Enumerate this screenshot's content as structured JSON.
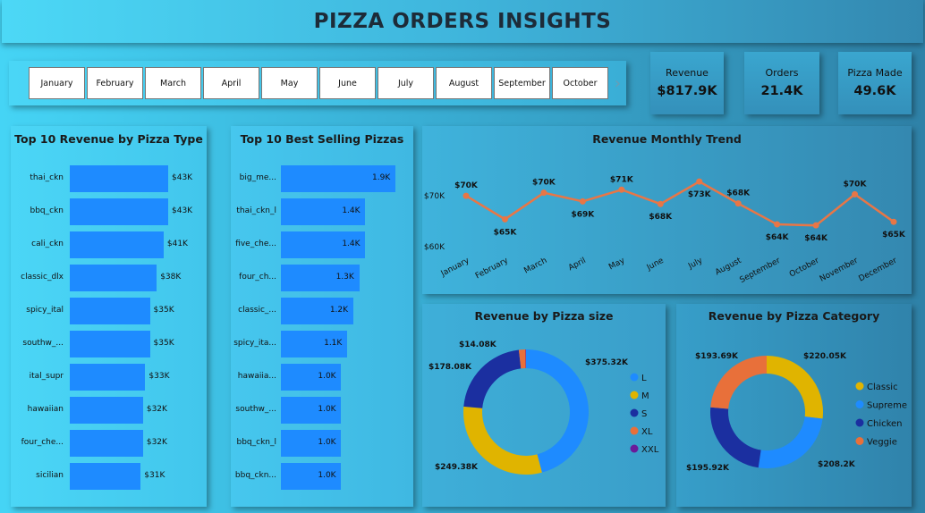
{
  "title": "PIZZA ORDERS INSIGHTS",
  "months": [
    "January",
    "February",
    "March",
    "April",
    "May",
    "June",
    "July",
    "August",
    "September",
    "October"
  ],
  "kpis": [
    {
      "label": "Revenue",
      "value": "$817.9K"
    },
    {
      "label": "Orders",
      "value": "21.4K"
    },
    {
      "label": "Pizza Made",
      "value": "49.6K"
    }
  ],
  "colors": {
    "bar": "#1e8bff",
    "line": "#e87646",
    "L": "#1e8bff",
    "M": "#e0b400",
    "S": "#1b2fa0",
    "XL": "#e8703a",
    "XXL": "#6a1b9a"
  },
  "chart_data": [
    {
      "type": "bar",
      "title": "Top 10 Revenue by Pizza Type",
      "categories": [
        "thai_ckn",
        "bbq_ckn",
        "cali_ckn",
        "classic_dlx",
        "spicy_ital",
        "southw_...",
        "ital_supr",
        "hawaiian",
        "four_che...",
        "sicilian"
      ],
      "values": [
        43,
        43,
        41,
        38,
        35,
        35,
        33,
        32,
        32,
        31
      ],
      "labels": [
        "$43K",
        "$43K",
        "$41K",
        "$38K",
        "$35K",
        "$35K",
        "$33K",
        "$32K",
        "$32K",
        "$31K"
      ]
    },
    {
      "type": "bar",
      "title": "Top 10 Best Selling Pizzas",
      "categories": [
        "big_me...",
        "thai_ckn_l",
        "five_che...",
        "four_ch...",
        "classic_...",
        "spicy_ita...",
        "hawaiia...",
        "southw_...",
        "bbq_ckn_l",
        "bbq_ckn..."
      ],
      "values": [
        1.9,
        1.4,
        1.4,
        1.3,
        1.2,
        1.1,
        1.0,
        1.0,
        1.0,
        1.0
      ],
      "labels": [
        "1.9K",
        "1.4K",
        "1.4K",
        "1.3K",
        "1.2K",
        "1.1K",
        "1.0K",
        "1.0K",
        "1.0K",
        "1.0K"
      ]
    },
    {
      "type": "line",
      "title": "Revenue Monthly Trend",
      "x": [
        "January",
        "February",
        "March",
        "April",
        "May",
        "June",
        "July",
        "August",
        "September",
        "October",
        "November",
        "December"
      ],
      "values": [
        69.8,
        65.2,
        70.4,
        68.7,
        71.0,
        68.2,
        72.6,
        68.3,
        64.2,
        64.0,
        70.1,
        64.7
      ],
      "labels": [
        "$70K",
        "$65K",
        "$70K",
        "$69K",
        "$71K",
        "$68K",
        "$73K",
        "$68K",
        "$64K",
        "$64K",
        "$70K",
        "$65K"
      ],
      "yticks": [
        "$70K",
        "$60K"
      ],
      "ylim": [
        60,
        75
      ]
    },
    {
      "type": "pie",
      "title": "Revenue by Pizza size",
      "categories": [
        "L",
        "M",
        "S",
        "XL",
        "XXL"
      ],
      "values": [
        375.32,
        249.38,
        178.08,
        14.08,
        1.0
      ],
      "labels": [
        "$375.32K",
        "$249.38K",
        "$178.08K",
        "$14.08K",
        ""
      ]
    },
    {
      "type": "pie",
      "title": "Revenue by Pizza Category",
      "categories": [
        "Classic",
        "Supreme",
        "Chicken",
        "Veggie"
      ],
      "values": [
        220.05,
        208.2,
        195.92,
        193.69
      ],
      "labels": [
        "$220.05K",
        "$208.2K",
        "$195.92K",
        "$193.69K"
      ]
    }
  ]
}
